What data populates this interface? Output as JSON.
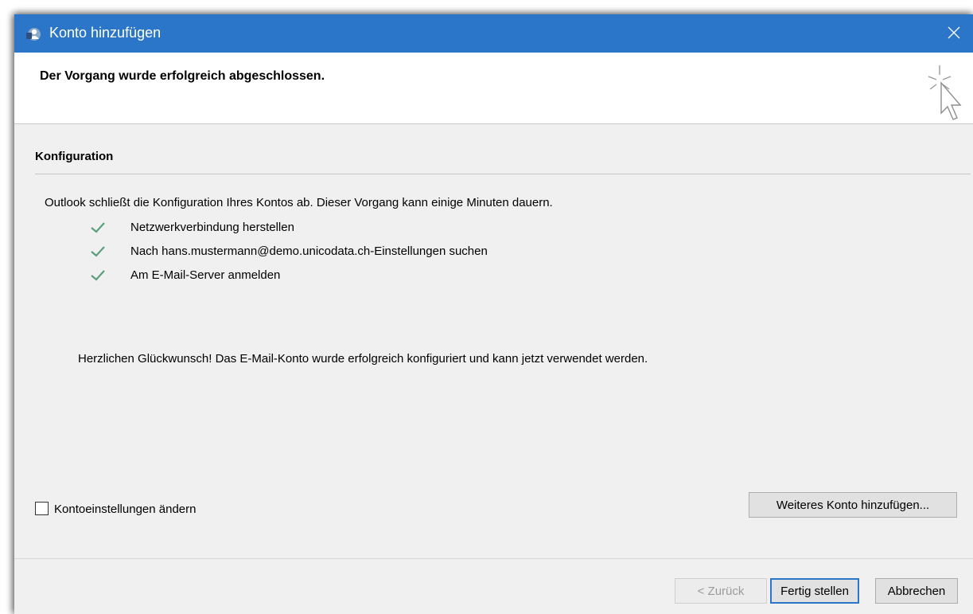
{
  "window": {
    "title": "Konto hinzufügen",
    "icons": {
      "app": "outlook-person-icon",
      "close": "close-icon",
      "wizard": "cursor-click-icon"
    }
  },
  "header": {
    "title": "Der Vorgang wurde erfolgreich abgeschlossen."
  },
  "section": {
    "title": "Konfiguration",
    "intro": "Outlook schließt die Konfiguration Ihres Kontos ab. Dieser Vorgang kann einige Minuten dauern.",
    "steps": [
      {
        "label": "Netzwerkverbindung herstellen",
        "status": "done"
      },
      {
        "label": "Nach hans.mustermann@demo.unicodata.ch-Einstellungen suchen",
        "status": "done"
      },
      {
        "label": "Am E-Mail-Server anmelden",
        "status": "done"
      }
    ],
    "congrats": "Herzlichen Glückwunsch! Das E-Mail-Konto wurde erfolgreich konfiguriert und kann jetzt verwendet werden."
  },
  "options": {
    "change_settings_label": "Kontoeinstellungen ändern",
    "change_settings_checked": false,
    "add_another_label": "Weiteres Konto hinzufügen..."
  },
  "footer": {
    "back_label": "< Zurück",
    "finish_label": "Fertig stellen",
    "cancel_label": "Abbrechen"
  },
  "colors": {
    "titlebar": "#2b76c8",
    "check": "#5a9f7a",
    "focus_border": "#2b76c8"
  }
}
